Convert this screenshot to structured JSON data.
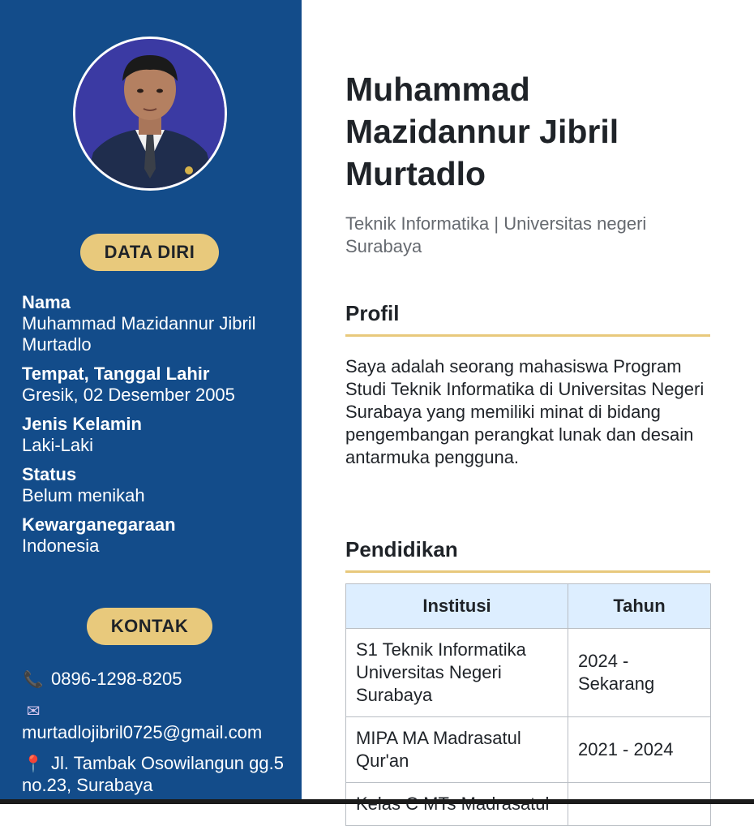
{
  "sidebar": {
    "data_diri_label": "DATA DIRI",
    "kontak_label": "KONTAK",
    "bio": [
      {
        "label": "Nama",
        "value": "Muhammad Mazidannur Jibril Murtadlo"
      },
      {
        "label": "Tempat, Tanggal Lahir",
        "value": "Gresik, 02 Desember 2005"
      },
      {
        "label": "Jenis Kelamin",
        "value": "Laki-Laki"
      },
      {
        "label": "Status",
        "value": "Belum menikah"
      },
      {
        "label": "Kewarganegaraan",
        "value": "Indonesia"
      }
    ],
    "contact": {
      "phone_icon": "📞",
      "phone": "0896-1298-8205",
      "email_icon": "✉",
      "email": "murtadlojibril0725@gmail.com",
      "address_icon": "📍",
      "address": "Jl. Tambak Osowilangun gg.5 no.23, Surabaya"
    }
  },
  "main": {
    "name": "Muhammad Mazidannur Jibril Murtadlo",
    "subtitle": "Teknik Informatika | Universitas negeri Surabaya",
    "profil_title": "Profil",
    "profil_text": "Saya adalah seorang mahasiswa Program Studi Teknik Informatika di Universitas Negeri Surabaya yang memiliki minat di bidang pengembangan perangkat lunak dan desain antarmuka pengguna.",
    "pendidikan_title": "Pendidikan",
    "table": {
      "headers": [
        "Institusi",
        "Tahun"
      ],
      "rows": [
        [
          "S1 Teknik Informatika Universitas Negeri Surabaya",
          "2024 - Sekarang"
        ],
        [
          "MIPA MA Madrasatul Qur'an",
          "2021 - 2024"
        ],
        [
          "Kelas C MTs Madrasatul",
          ""
        ]
      ]
    }
  },
  "colors": {
    "sidebar_bg": "#134c8a",
    "accent": "#e8c97c",
    "table_header_bg": "#ddeeff"
  }
}
